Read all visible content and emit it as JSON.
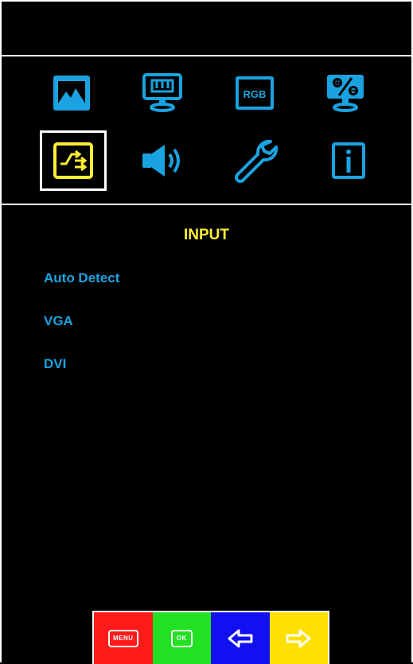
{
  "osd": {
    "section_title": "INPUT",
    "menu_items": [
      {
        "label": "Auto Detect"
      },
      {
        "label": "VGA"
      },
      {
        "label": "DVI"
      }
    ],
    "icons": [
      {
        "name": "picture-icon",
        "selected": false
      },
      {
        "name": "display-settings-icon",
        "selected": false
      },
      {
        "name": "rgb-icon",
        "selected": false,
        "text": "RGB"
      },
      {
        "name": "percentage-icon",
        "selected": false
      },
      {
        "name": "input-source-icon",
        "selected": true
      },
      {
        "name": "speaker-icon",
        "selected": false
      },
      {
        "name": "wrench-icon",
        "selected": false
      },
      {
        "name": "info-icon",
        "selected": false
      }
    ],
    "buttons": {
      "menu_label": "MENU",
      "ok_label": "OK",
      "left_icon": "left-arrow-icon",
      "right_icon": "right-arrow-icon"
    }
  },
  "colors": {
    "background": "#000000",
    "icon_blue": "#1aa3e0",
    "selected_yellow": "#ffee33",
    "menu_red": "#ff1a1a",
    "ok_green": "#22e022",
    "left_blue": "#1010f0",
    "right_yellow": "#ffe000"
  }
}
